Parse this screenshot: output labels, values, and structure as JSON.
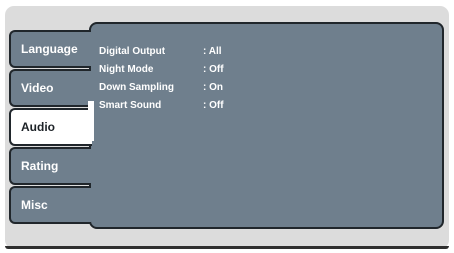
{
  "tabs": [
    {
      "label": "Language",
      "active": false
    },
    {
      "label": "Video",
      "active": false
    },
    {
      "label": "Audio",
      "active": true
    },
    {
      "label": "Rating",
      "active": false
    },
    {
      "label": "Misc",
      "active": false
    }
  ],
  "settings": [
    {
      "name": "Digital Output",
      "value": ": All"
    },
    {
      "name": "Night Mode",
      "value": ": Off"
    },
    {
      "name": "Down Sampling",
      "value": ": On"
    },
    {
      "name": "Smart Sound",
      "value": ": Off"
    }
  ],
  "colors": {
    "panel": "#6f7f8d",
    "frame": "#dcdcdc",
    "border": "#20262b",
    "active_tab": "#ffffff"
  }
}
